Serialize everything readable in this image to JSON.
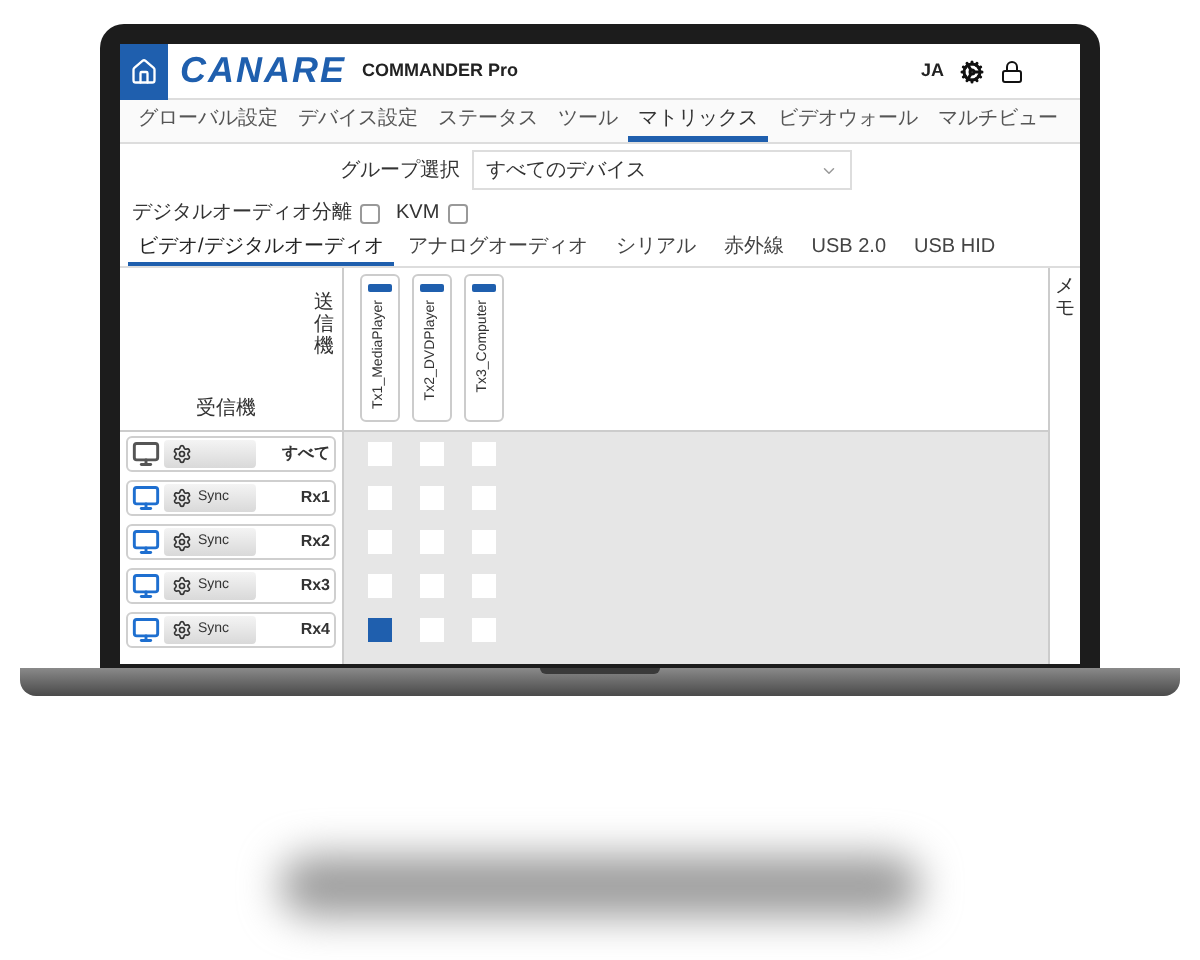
{
  "header": {
    "logo": "CANARE",
    "product": "COMMANDER Pro",
    "language": "JA"
  },
  "nav_tabs": [
    {
      "label": "グローバル設定",
      "selected": false
    },
    {
      "label": "デバイス設定",
      "selected": false
    },
    {
      "label": "ステータス",
      "selected": false
    },
    {
      "label": "ツール",
      "selected": false
    },
    {
      "label": "マトリックス",
      "selected": true
    },
    {
      "label": "ビデオウォール",
      "selected": false
    },
    {
      "label": "マルチビュー",
      "selected": false
    }
  ],
  "group_select": {
    "label": "グループ選択",
    "value": "すべてのデバイス"
  },
  "options": [
    {
      "label": "デジタルオーディオ分離",
      "checked": false
    },
    {
      "label": "KVM",
      "checked": false
    }
  ],
  "sub_tabs": [
    {
      "label": "ビデオ/デジタルオーディオ",
      "selected": true
    },
    {
      "label": "アナログオーディオ",
      "selected": false
    },
    {
      "label": "シリアル",
      "selected": false
    },
    {
      "label": "赤外線",
      "selected": false
    },
    {
      "label": "USB 2.0",
      "selected": false
    },
    {
      "label": "USB HID",
      "selected": false
    }
  ],
  "matrix": {
    "tx_header": "送信機",
    "rx_header": "受信機",
    "memo_header": "メモ",
    "transmitters": [
      "Tx1_MediaPlayer",
      "Tx2_DVDPlayer",
      "Tx3_Computer"
    ],
    "receivers": [
      {
        "kind": "all",
        "name": "すべて",
        "cells": [
          {
            "selected": false
          },
          {
            "selected": false
          },
          {
            "selected": false
          }
        ]
      },
      {
        "kind": "rx",
        "name": "Rx1",
        "sync": "Sync",
        "cells": [
          {
            "selected": false
          },
          {
            "selected": false
          },
          {
            "selected": false
          }
        ]
      },
      {
        "kind": "rx",
        "name": "Rx2",
        "sync": "Sync",
        "cells": [
          {
            "selected": false
          },
          {
            "selected": false
          },
          {
            "selected": false
          }
        ]
      },
      {
        "kind": "rx",
        "name": "Rx3",
        "sync": "Sync",
        "cells": [
          {
            "selected": false
          },
          {
            "selected": false
          },
          {
            "selected": false
          }
        ]
      },
      {
        "kind": "rx",
        "name": "Rx4",
        "sync": "Sync",
        "cells": [
          {
            "selected": true
          },
          {
            "selected": false
          },
          {
            "selected": false
          }
        ]
      }
    ]
  }
}
